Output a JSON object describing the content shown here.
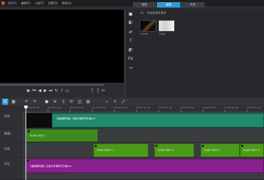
{
  "menubar": {
    "items": [
      "文件(F)",
      "编辑(E)",
      "工具(T)",
      "设置(S)",
      "帮助(H)"
    ]
  },
  "steps": [
    {
      "label": "捕获",
      "active": false
    },
    {
      "label": "编辑",
      "active": true
    },
    {
      "label": "共享",
      "active": false
    }
  ],
  "library": {
    "path": "Ov · 添加新媒体素材",
    "thumbnails": [
      {
        "label": "1.mp4"
      },
      {
        "label": "2.jpg"
      }
    ],
    "icons": [
      "media-icon",
      "instant-project-icon",
      "transition-icon",
      "title-icon",
      "graphics-icon",
      "filter-icon",
      "path-icon"
    ]
  },
  "transport": {
    "timecode": "00:00:00:00",
    "progress": 0.0
  },
  "toolbar": {
    "tools": [
      "timeline-view-icon",
      "storyboard-view-icon",
      "undo-icon",
      "redo-icon",
      "record-icon",
      "mixer-icon",
      "auto-music-icon",
      "motion-icon",
      "split-screen-icon",
      "subtitle-icon",
      "zoom-out-icon",
      "zoom-in-icon",
      "fit-icon"
    ]
  },
  "ruler": {
    "labels": [
      "00:00:00:00",
      "00:00:01:00",
      "00:00:02:00",
      "00:00:03:00",
      "00:00:04:00",
      "00:00:05:00",
      "00:00:06:00",
      "00:00:07:00",
      "00:00:08:00",
      "00:00:09:00",
      "00:00:10:00"
    ]
  },
  "tracks": [
    {
      "name": "视频"
    },
    {
      "name": "覆叠1"
    },
    {
      "name": "标题"
    },
    {
      "name": "声音"
    }
  ],
  "clips": {
    "video_label": "【重组素材板】正版字幕样式升级ver.",
    "overlay_label": "YOUR TEXT 1",
    "title_labels": [
      "YOUR TEXT 2",
      "YOUR TEXT 3",
      "YOUR TEXT 4",
      "YOUR TEXT 5"
    ],
    "audio_label": "【重组素材板】正版文字幕样式升级ver."
  },
  "colors": {
    "accent": "#2e9bd6",
    "video_clip": "#1f8a6d",
    "overlay_clip": "#3e8a1f",
    "title_clip": "#4c9a1a",
    "audio_clip": "#8a1f8f"
  }
}
